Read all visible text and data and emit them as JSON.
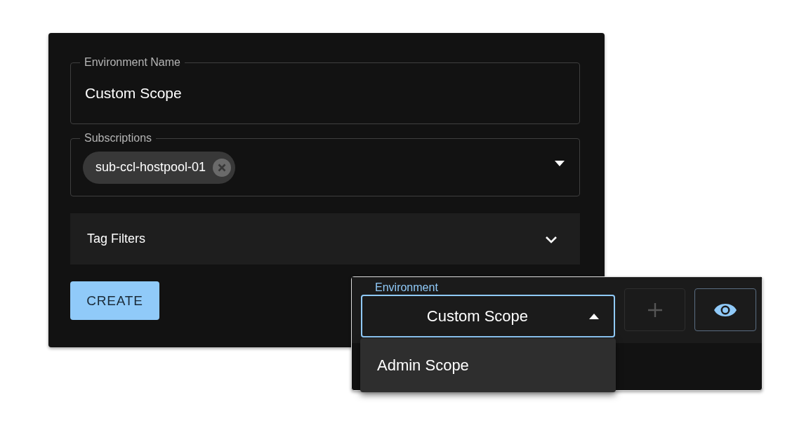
{
  "environment_form": {
    "environment_name": {
      "label": "Environment Name",
      "value": "Custom Scope"
    },
    "subscriptions": {
      "label": "Subscriptions",
      "chips": [
        "sub-ccl-hostpool-01"
      ]
    },
    "tag_filters": {
      "label": "Tag Filters",
      "expanded": false
    },
    "create_button": {
      "label": "CREATE"
    }
  },
  "environment_toolbar": {
    "environment_select": {
      "label": "Environment",
      "value": "Custom Scope",
      "open": true,
      "options": [
        {
          "label": "Admin Scope",
          "selected": false
        }
      ]
    },
    "add_button": {
      "disabled": true
    },
    "view_button": {
      "disabled": false
    }
  }
}
